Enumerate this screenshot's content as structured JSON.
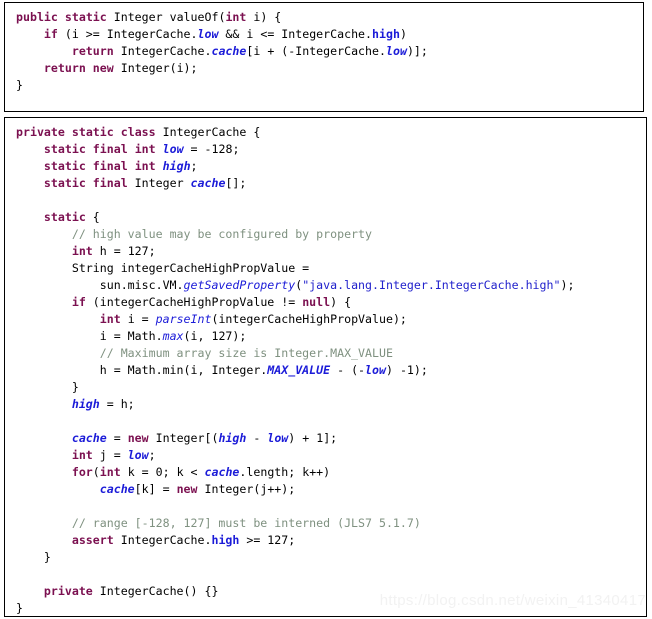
{
  "watermark": "https://blog.csdn.net/weixin_41340417",
  "top_block": {
    "title": "Integer.valueOf source",
    "lines": [
      [
        {
          "t": "public",
          "c": "kw"
        },
        {
          "t": " ",
          "c": "plain"
        },
        {
          "t": "static",
          "c": "kw"
        },
        {
          "t": " Integer valueOf(",
          "c": "plain"
        },
        {
          "t": "int",
          "c": "kw"
        },
        {
          "t": " i) {",
          "c": "plain"
        }
      ],
      [
        {
          "t": "    ",
          "c": "plain"
        },
        {
          "t": "if",
          "c": "kw"
        },
        {
          "t": " (i >= IntegerCache.",
          "c": "plain"
        },
        {
          "t": "low",
          "c": "fld"
        },
        {
          "t": " && i <= IntegerCache.",
          "c": "plain"
        },
        {
          "t": "high",
          "c": "fldn"
        },
        {
          "t": ")",
          "c": "plain"
        }
      ],
      [
        {
          "t": "        ",
          "c": "plain"
        },
        {
          "t": "return",
          "c": "kw"
        },
        {
          "t": " IntegerCache.",
          "c": "plain"
        },
        {
          "t": "cache",
          "c": "fld"
        },
        {
          "t": "[i + (-IntegerCache.",
          "c": "plain"
        },
        {
          "t": "low",
          "c": "fld"
        },
        {
          "t": ")];",
          "c": "plain"
        }
      ],
      [
        {
          "t": "    ",
          "c": "plain"
        },
        {
          "t": "return",
          "c": "kw"
        },
        {
          "t": " ",
          "c": "plain"
        },
        {
          "t": "new",
          "c": "kw"
        },
        {
          "t": " Integer(i);",
          "c": "plain"
        }
      ],
      [
        {
          "t": "}",
          "c": "plain"
        }
      ],
      [
        {
          "t": "",
          "c": "plain"
        }
      ]
    ]
  },
  "bottom_block": {
    "title": "IntegerCache inner class source",
    "lines": [
      [
        {
          "t": "private",
          "c": "kw"
        },
        {
          "t": " ",
          "c": "plain"
        },
        {
          "t": "static",
          "c": "kw"
        },
        {
          "t": " ",
          "c": "plain"
        },
        {
          "t": "class",
          "c": "kw"
        },
        {
          "t": " IntegerCache {",
          "c": "plain"
        }
      ],
      [
        {
          "t": "    ",
          "c": "plain"
        },
        {
          "t": "static",
          "c": "kw"
        },
        {
          "t": " ",
          "c": "plain"
        },
        {
          "t": "final",
          "c": "kw"
        },
        {
          "t": " ",
          "c": "plain"
        },
        {
          "t": "int",
          "c": "kw"
        },
        {
          "t": " ",
          "c": "plain"
        },
        {
          "t": "low",
          "c": "fld"
        },
        {
          "t": " = -128;",
          "c": "plain"
        }
      ],
      [
        {
          "t": "    ",
          "c": "plain"
        },
        {
          "t": "static",
          "c": "kw"
        },
        {
          "t": " ",
          "c": "plain"
        },
        {
          "t": "final",
          "c": "kw"
        },
        {
          "t": " ",
          "c": "plain"
        },
        {
          "t": "int",
          "c": "kw"
        },
        {
          "t": " ",
          "c": "plain"
        },
        {
          "t": "high",
          "c": "fld"
        },
        {
          "t": ";",
          "c": "plain"
        }
      ],
      [
        {
          "t": "    ",
          "c": "plain"
        },
        {
          "t": "static",
          "c": "kw"
        },
        {
          "t": " ",
          "c": "plain"
        },
        {
          "t": "final",
          "c": "kw"
        },
        {
          "t": " Integer ",
          "c": "plain"
        },
        {
          "t": "cache",
          "c": "fld"
        },
        {
          "t": "[];",
          "c": "plain"
        }
      ],
      [
        {
          "t": "",
          "c": "plain"
        }
      ],
      [
        {
          "t": "    ",
          "c": "plain"
        },
        {
          "t": "static",
          "c": "kw"
        },
        {
          "t": " {",
          "c": "plain"
        }
      ],
      [
        {
          "t": "        ",
          "c": "plain"
        },
        {
          "t": "// high value may be configured by property",
          "c": "cmt"
        }
      ],
      [
        {
          "t": "        ",
          "c": "plain"
        },
        {
          "t": "int",
          "c": "kw"
        },
        {
          "t": " h = 127;",
          "c": "plain"
        }
      ],
      [
        {
          "t": "        String integerCacheHighPropValue =",
          "c": "plain"
        }
      ],
      [
        {
          "t": "            sun.misc.VM.",
          "c": "plain"
        },
        {
          "t": "getSavedProperty",
          "c": "mth"
        },
        {
          "t": "(",
          "c": "plain"
        },
        {
          "t": "\"java.lang.Integer.IntegerCache.high\"",
          "c": "str"
        },
        {
          "t": ");",
          "c": "plain"
        }
      ],
      [
        {
          "t": "        ",
          "c": "plain"
        },
        {
          "t": "if",
          "c": "kw"
        },
        {
          "t": " (integerCacheHighPropValue != ",
          "c": "plain"
        },
        {
          "t": "null",
          "c": "kw"
        },
        {
          "t": ") {",
          "c": "plain"
        }
      ],
      [
        {
          "t": "            ",
          "c": "plain"
        },
        {
          "t": "int",
          "c": "kw"
        },
        {
          "t": " i = ",
          "c": "plain"
        },
        {
          "t": "parseInt",
          "c": "mth"
        },
        {
          "t": "(integerCacheHighPropValue);",
          "c": "plain"
        }
      ],
      [
        {
          "t": "            i = Math.",
          "c": "plain"
        },
        {
          "t": "max",
          "c": "mth"
        },
        {
          "t": "(i, 127);",
          "c": "plain"
        }
      ],
      [
        {
          "t": "            ",
          "c": "plain"
        },
        {
          "t": "// Maximum array size is Integer.MAX_VALUE",
          "c": "cmt"
        }
      ],
      [
        {
          "t": "            h = Math.min(i, Integer.",
          "c": "plain"
        },
        {
          "t": "MAX_VALUE",
          "c": "fld"
        },
        {
          "t": " - ",
          "c": "plain"
        },
        {
          "t": "(-",
          "c": "plain"
        },
        {
          "t": "low",
          "c": "fld"
        },
        {
          "t": ")",
          "c": "plain"
        },
        {
          "t": " -1);",
          "c": "plain"
        }
      ],
      [
        {
          "t": "        }",
          "c": "plain"
        }
      ],
      [
        {
          "t": "        ",
          "c": "plain"
        },
        {
          "t": "high",
          "c": "fld"
        },
        {
          "t": " = h;",
          "c": "plain"
        }
      ],
      [
        {
          "t": "",
          "c": "plain"
        }
      ],
      [
        {
          "t": "        ",
          "c": "plain"
        },
        {
          "t": "cache",
          "c": "fld"
        },
        {
          "t": " = ",
          "c": "plain"
        },
        {
          "t": "new",
          "c": "kw"
        },
        {
          "t": " Integer[(",
          "c": "plain"
        },
        {
          "t": "high",
          "c": "fld"
        },
        {
          "t": " - ",
          "c": "plain"
        },
        {
          "t": "low",
          "c": "fld"
        },
        {
          "t": ") + 1];",
          "c": "plain"
        }
      ],
      [
        {
          "t": "        ",
          "c": "plain"
        },
        {
          "t": "int",
          "c": "kw"
        },
        {
          "t": " j = ",
          "c": "plain"
        },
        {
          "t": "low",
          "c": "fld"
        },
        {
          "t": ";",
          "c": "plain"
        }
      ],
      [
        {
          "t": "        ",
          "c": "plain"
        },
        {
          "t": "for",
          "c": "kw"
        },
        {
          "t": "(",
          "c": "plain"
        },
        {
          "t": "int",
          "c": "kw"
        },
        {
          "t": " k = 0; k < ",
          "c": "plain"
        },
        {
          "t": "cache",
          "c": "fld"
        },
        {
          "t": ".length; k++)",
          "c": "plain"
        }
      ],
      [
        {
          "t": "            ",
          "c": "plain"
        },
        {
          "t": "cache",
          "c": "fld"
        },
        {
          "t": "[k] = ",
          "c": "plain"
        },
        {
          "t": "new",
          "c": "kw"
        },
        {
          "t": " Integer(j++);",
          "c": "plain"
        }
      ],
      [
        {
          "t": "",
          "c": "plain"
        }
      ],
      [
        {
          "t": "        ",
          "c": "plain"
        },
        {
          "t": "// range [-128, 127] must be interned (JLS7 5.1.7)",
          "c": "cmt"
        }
      ],
      [
        {
          "t": "        ",
          "c": "plain"
        },
        {
          "t": "assert",
          "c": "kw"
        },
        {
          "t": " IntegerCache.",
          "c": "plain"
        },
        {
          "t": "high",
          "c": "fldn"
        },
        {
          "t": " >= 127;",
          "c": "plain"
        }
      ],
      [
        {
          "t": "    }",
          "c": "plain"
        }
      ],
      [
        {
          "t": "",
          "c": "plain"
        }
      ],
      [
        {
          "t": "    ",
          "c": "plain"
        },
        {
          "t": "private",
          "c": "kw"
        },
        {
          "t": " IntegerCache() {}",
          "c": "plain"
        }
      ],
      [
        {
          "t": "}",
          "c": "plain"
        }
      ]
    ]
  }
}
